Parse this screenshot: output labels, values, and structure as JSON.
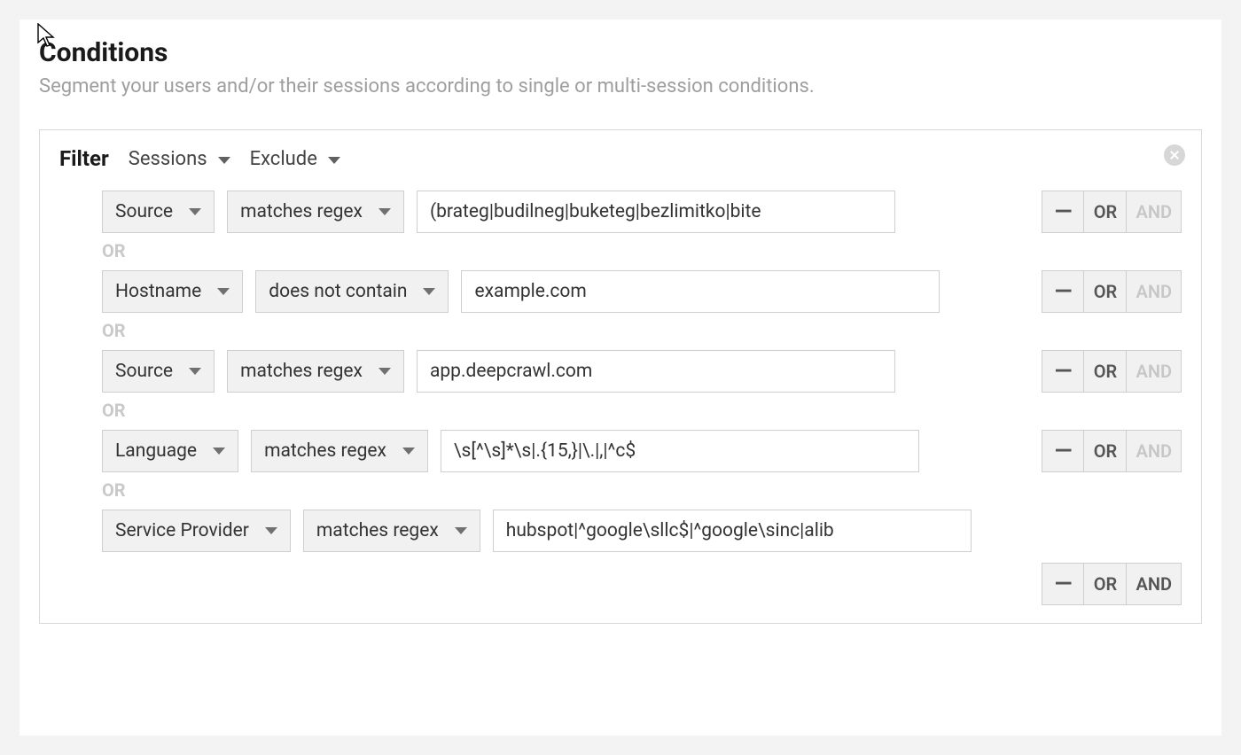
{
  "title": "Conditions",
  "subtitle": "Segment your users and/or their sessions according to single or multi-session conditions.",
  "filter_label": "Filter",
  "scope_select": "Sessions",
  "mode_select": "Exclude",
  "sep_label": "OR",
  "buttons": {
    "minus": "—",
    "or": "OR",
    "and": "AND"
  },
  "rows": [
    {
      "dim": "Source",
      "op": "matches regex",
      "val": "(brateg|budilneg|buketeg|bezlimitko|bite",
      "and_enabled": false,
      "val_w": 540
    },
    {
      "dim": "Hostname",
      "op": "does not contain",
      "val": "example.com",
      "and_enabled": false,
      "val_w": 540
    },
    {
      "dim": "Source",
      "op": "matches regex",
      "val": "app.deepcrawl.com",
      "and_enabled": false,
      "val_w": 540
    },
    {
      "dim": "Language",
      "op": "matches regex",
      "val": "\\s[^\\s]*\\s|.{15,}|\\.|,|^c$",
      "and_enabled": false,
      "val_w": 540
    },
    {
      "dim": "Service Provider",
      "op": "matches regex",
      "val": "hubspot|^google\\sllc$|^google\\sinc|alib",
      "and_enabled": true,
      "val_w": 540
    }
  ]
}
